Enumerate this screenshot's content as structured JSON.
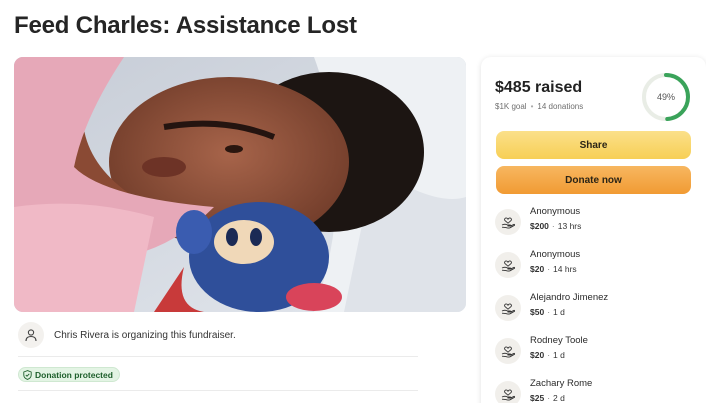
{
  "page": {
    "title": "Feed Charles: Assistance Lost"
  },
  "organizer": {
    "text": "Chris Rivera is organizing this fundraiser."
  },
  "badge": {
    "label": "Donation protected"
  },
  "summary": {
    "raised": "$485 raised",
    "goal": "$1K goal",
    "donations": "14 donations",
    "percent_label": "49%",
    "percent_value": 49,
    "ring_color": "#3aa35a",
    "ring_track_color": "#e9ede6"
  },
  "buttons": {
    "share": "Share",
    "donate": "Donate now"
  },
  "donations": [
    {
      "name": "Anonymous",
      "amount": "$200",
      "time": "13 hrs"
    },
    {
      "name": "Anonymous",
      "amount": "$20",
      "time": "14 hrs"
    },
    {
      "name": "Alejandro Jimenez",
      "amount": "$50",
      "time": "1 d"
    },
    {
      "name": "Rodney Toole",
      "amount": "$20",
      "time": "1 d"
    },
    {
      "name": "Zachary Rome",
      "amount": "$25",
      "time": "2 d"
    }
  ],
  "icons": {
    "organizer": "person-icon",
    "badge": "shield-check-icon",
    "donor": "heart-hand-icon"
  }
}
